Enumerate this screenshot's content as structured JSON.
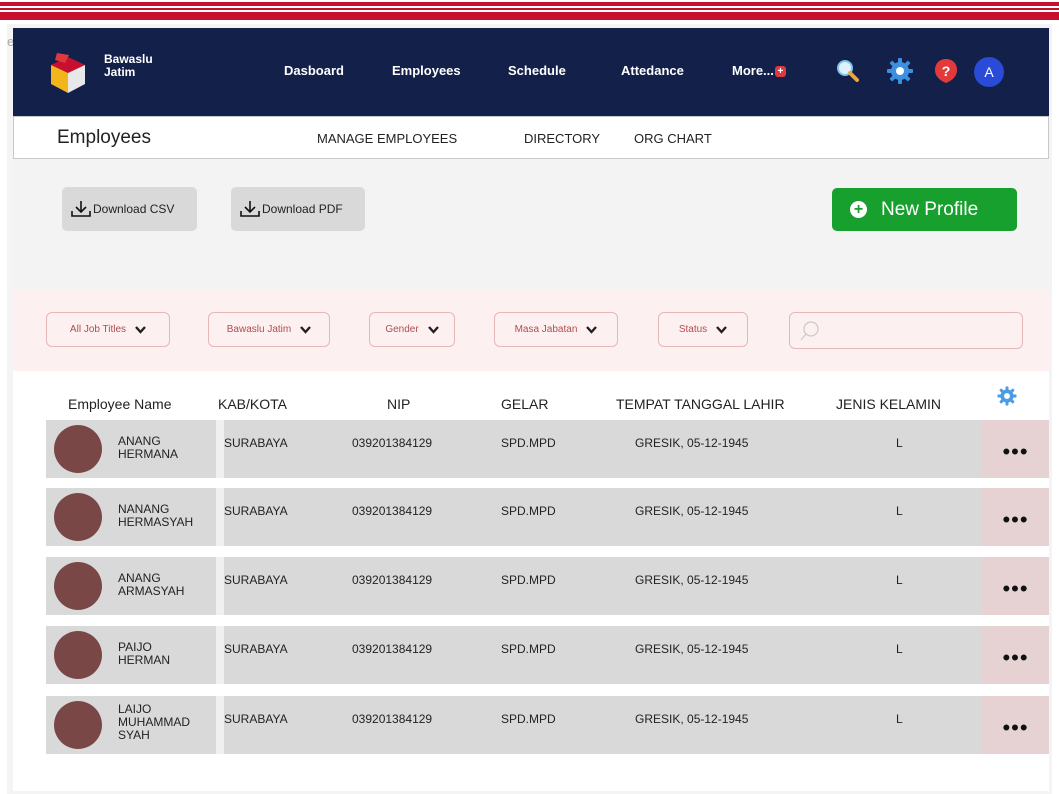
{
  "frame_label": "employees",
  "brand": {
    "line1": "Bawaslu",
    "line2": "Jatim"
  },
  "nav": {
    "links": [
      "Dasboard",
      "Employees",
      "Schedule",
      "Attedance",
      "More..."
    ],
    "avatar_initial": "A"
  },
  "subnav": {
    "title": "Employees",
    "tabs": [
      "MANAGE EMPLOYEES",
      "DIRECTORY",
      "ORG CHART"
    ]
  },
  "actions": {
    "download_csv": "Download CSV",
    "download_pdf": "Download PDF",
    "new_profile": "New Profile"
  },
  "filters": {
    "job_titles": "All Job Titles",
    "office": "Bawaslu Jatim",
    "gender": "Gender",
    "masa_jabatan": "Masa Jabatan",
    "status": "Status",
    "search_placeholder": ""
  },
  "table": {
    "columns": [
      "Employee Name",
      "KAB/KOTA",
      "NIP",
      "GELAR",
      "TEMPAT TANGGAL LAHIR",
      "JENIS KELAMIN"
    ],
    "rows": [
      {
        "name": "ANANG\nHERMANA",
        "kab": "SURABAYA",
        "nip": "039201384129",
        "gelar": "SPD.MPD",
        "ttl": "GRESIK, 05-12-1945",
        "jk": "L"
      },
      {
        "name": "NANANG\nHERMASYAH",
        "kab": "SURABAYA",
        "nip": "039201384129",
        "gelar": "SPD.MPD",
        "ttl": "GRESIK, 05-12-1945",
        "jk": "L"
      },
      {
        "name": "ANANG\nARMASYAH",
        "kab": "SURABAYA",
        "nip": "039201384129",
        "gelar": "SPD.MPD",
        "ttl": "GRESIK, 05-12-1945",
        "jk": "L"
      },
      {
        "name": "PAIJO\nHERMAN",
        "kab": "SURABAYA",
        "nip": "039201384129",
        "gelar": "SPD.MPD",
        "ttl": "GRESIK, 05-12-1945",
        "jk": "L"
      },
      {
        "name": "LAIJO\nMUHAMMAD\nSYAH",
        "kab": "SURABAYA",
        "nip": "039201384129",
        "gelar": "SPD.MPD",
        "ttl": "GRESIK, 05-12-1945",
        "jk": "L"
      }
    ],
    "more_label": "•••"
  },
  "icons": {
    "nav": [
      "search-icon",
      "gear-icon",
      "help-icon"
    ],
    "table_settings": "gear-icon",
    "download": "download-icon",
    "add": "plus-circle-icon",
    "dropdown": "chevron-down-icon"
  },
  "colors": {
    "nav_bg": "#13214a",
    "accent_green": "#18a02f",
    "brand_red": "#c8102e",
    "avatar_bg": "#2a4ad8",
    "row_avatar": "#7a4747",
    "filter_bg": "#fdf0f0"
  }
}
